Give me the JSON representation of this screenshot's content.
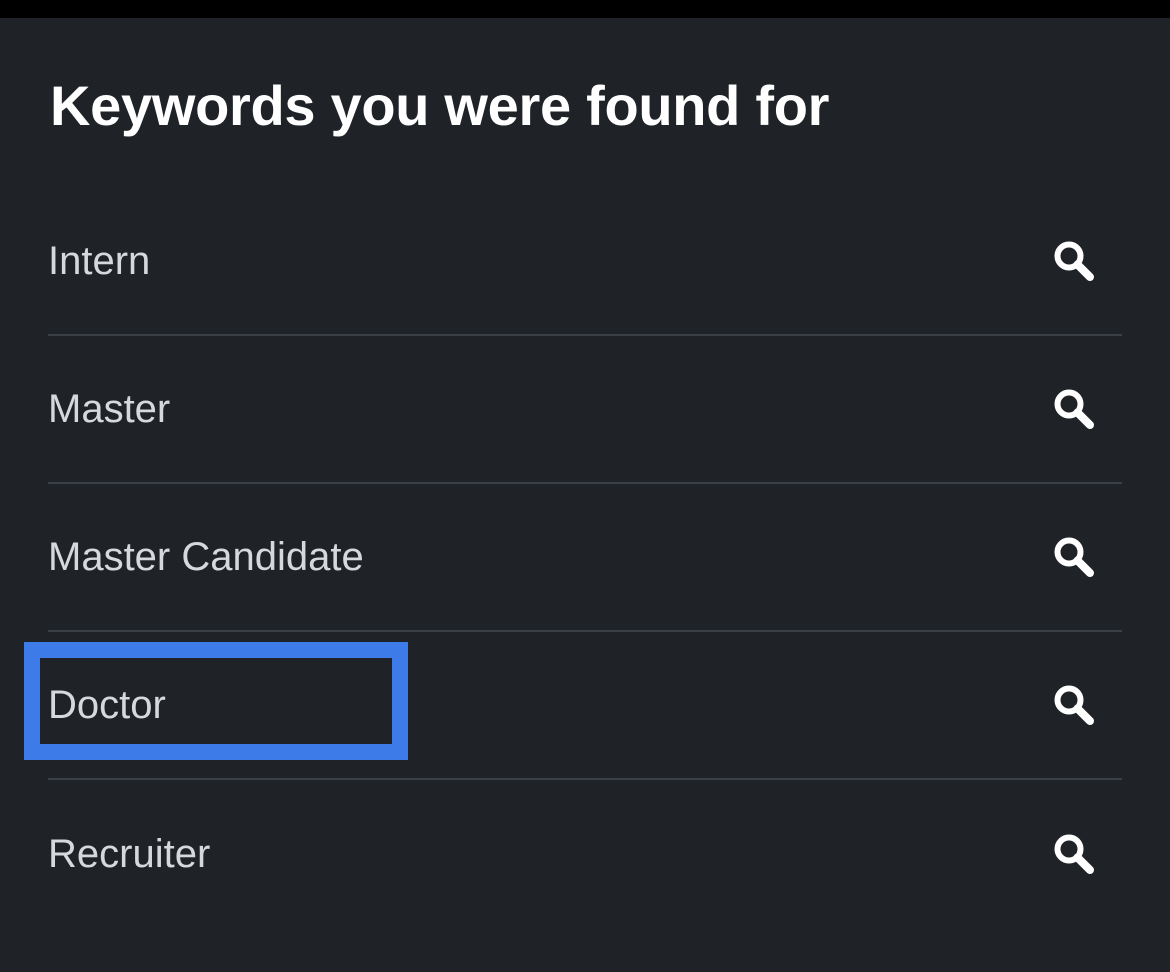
{
  "header": {
    "title": "Keywords you were found for"
  },
  "keywords": [
    {
      "label": "Intern",
      "icon": "search-icon"
    },
    {
      "label": "Master",
      "icon": "search-icon"
    },
    {
      "label": "Master Candidate",
      "icon": "search-icon"
    },
    {
      "label": "Doctor",
      "icon": "search-icon",
      "highlighted": true
    },
    {
      "label": "Recruiter",
      "icon": "search-icon"
    }
  ],
  "colors": {
    "background": "#1f2328",
    "title": "#ffffff",
    "label": "#d6d8db",
    "divider": "#3a3f45",
    "highlight": "#3d7be8"
  }
}
